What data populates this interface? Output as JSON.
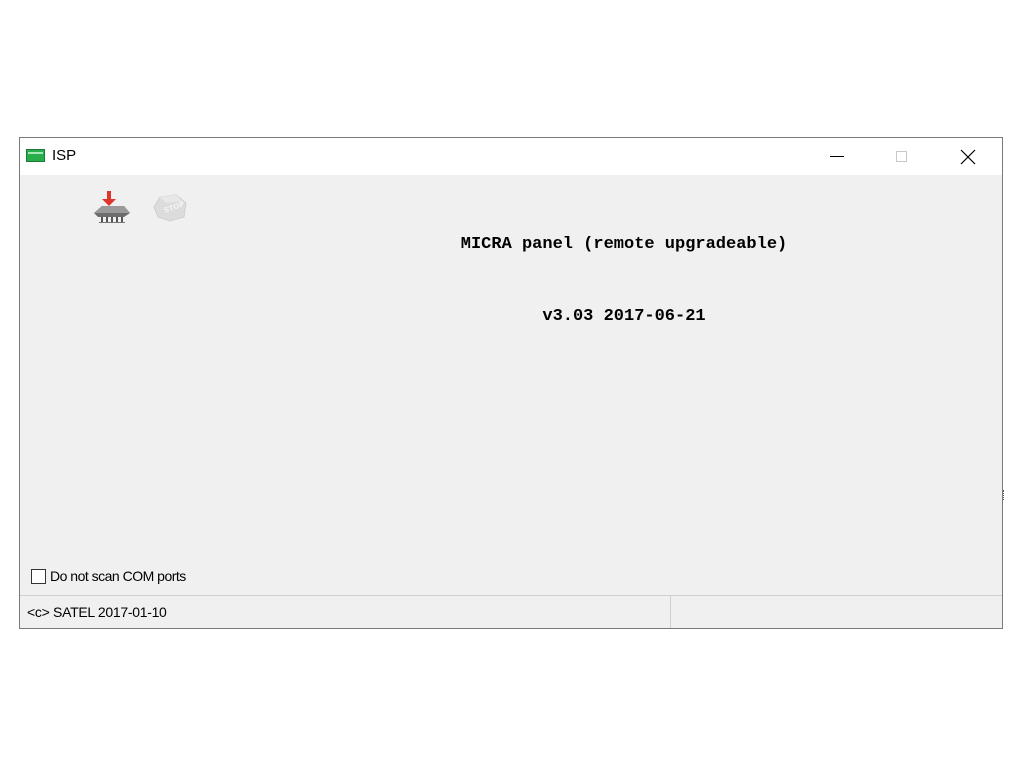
{
  "window": {
    "title": "ISP",
    "icon": "app-green-icon"
  },
  "caption_buttons": {
    "minimize": "minimize-icon",
    "maximize": "maximize-icon",
    "close": "close-icon"
  },
  "toolbar": {
    "program_icon": "chip-program-icon",
    "stop_icon": "stop-icon",
    "stop_icon_text": "STOP"
  },
  "firmware": {
    "line1": "MICRA panel (remote upgradeable)",
    "line2": "v3.03 2017-06-21"
  },
  "options": {
    "do_not_scan_label": "Do not scan COM ports",
    "do_not_scan_checked": false
  },
  "statusbar": {
    "left_text": "<c> SATEL 2017-01-10",
    "right_text": ""
  },
  "colors": {
    "window_bg": "#f0f0f0",
    "titlebar_bg": "#ffffff",
    "icon_green": "#27ad4a",
    "arrow_red": "#e0352b"
  }
}
